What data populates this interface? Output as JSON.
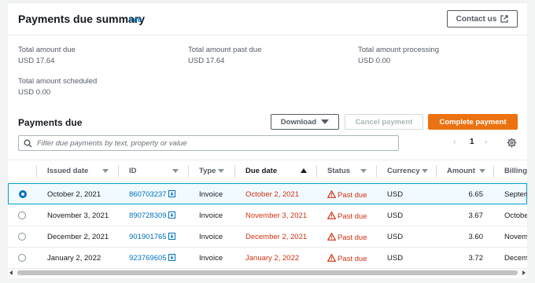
{
  "summary": {
    "title": "Payments due summary",
    "info": "Info",
    "contact_label": "Contact us",
    "metrics": [
      {
        "label": "Total amount due",
        "value": "USD 17.64"
      },
      {
        "label": "Total amount past due",
        "value": "USD 17.64"
      },
      {
        "label": "Total amount processing",
        "value": "USD 0.00"
      },
      {
        "label": "Total amount scheduled",
        "value": "USD 0.00"
      }
    ]
  },
  "table": {
    "title": "Payments due",
    "download_label": "Download",
    "cancel_label": "Cancel payment",
    "complete_label": "Complete payment",
    "search_placeholder": "Filter due payments by text, property or value",
    "pagination": {
      "prev": "‹",
      "page": "1",
      "next": "›"
    },
    "columns": [
      "Issued date",
      "ID",
      "Type",
      "Due date",
      "Status",
      "Currency",
      "Amount",
      "Billing"
    ],
    "rows": [
      {
        "issued": "October 2, 2021",
        "id": "860703237",
        "type": "Invoice",
        "due": "October 2, 2021",
        "status": "Past due",
        "currency": "USD",
        "amount": "6.65",
        "billing": "Septem",
        "selected": true
      },
      {
        "issued": "November 3, 2021",
        "id": "890728309",
        "type": "Invoice",
        "due": "November 3, 2021",
        "status": "Past due",
        "currency": "USD",
        "amount": "3.67",
        "billing": "October",
        "selected": false
      },
      {
        "issued": "December 2, 2021",
        "id": "901901765",
        "type": "Invoice",
        "due": "December 2, 2021",
        "status": "Past due",
        "currency": "USD",
        "amount": "3.60",
        "billing": "Novem",
        "selected": false
      },
      {
        "issued": "January 2, 2022",
        "id": "923769605",
        "type": "Invoice",
        "due": "January 2, 2022",
        "status": "Past due",
        "currency": "USD",
        "amount": "3.72",
        "billing": "Decemb",
        "selected": false
      }
    ]
  },
  "colors": {
    "accent": "#0073bb",
    "primary_button": "#ec7211",
    "error": "#d13212"
  },
  "icons": [
    "external-link-icon",
    "caret-down-icon",
    "search-icon",
    "settings-icon",
    "download-icon",
    "warning-icon",
    "sort-icon"
  ]
}
